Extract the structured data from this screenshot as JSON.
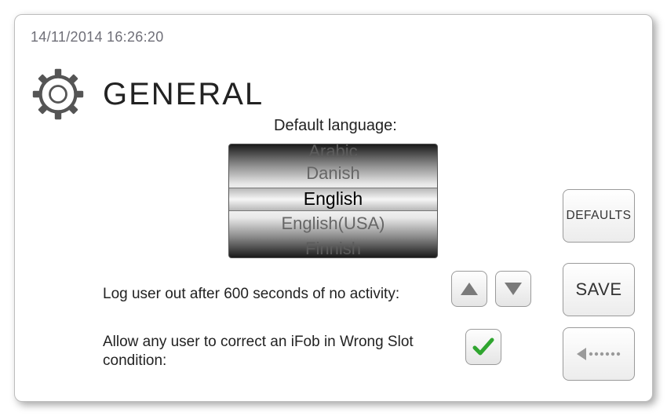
{
  "timestamp": "14/11/2014 16:26:20",
  "page_title": "GENERAL",
  "language": {
    "label": "Default language:",
    "options": [
      "Arabic",
      "Danish",
      "English",
      "English(USA)",
      "Finnish"
    ],
    "selected": "English"
  },
  "logout": {
    "seconds": 600,
    "label_prefix": "Log user out after ",
    "label_suffix": " seconds of no activity:",
    "full_label": "Log user out after 600 seconds of no activity:"
  },
  "ifob": {
    "label": "Allow any user to correct an iFob in Wrong Slot condition:",
    "checked": true
  },
  "buttons": {
    "defaults": "DEFAULTS",
    "save": "SAVE"
  },
  "colors": {
    "check_green": "#2fa52f",
    "text_muted": "#6f6f78",
    "arrow_gray": "#7a7a7a",
    "dots_gray": "#9a9a9a"
  }
}
